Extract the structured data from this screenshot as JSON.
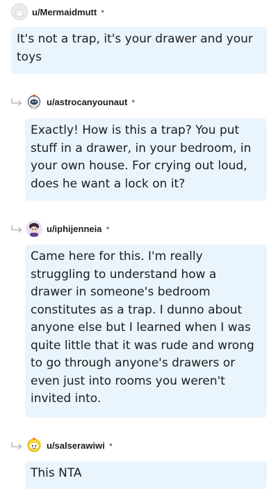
{
  "comments": [
    {
      "username": "u/Mermaidmutt",
      "separator": "•",
      "body": "It's not a trap, it's your drawer and your toys",
      "avatar": "default-grey-avatar-icon"
    },
    {
      "username": "u/astrocanyounaut",
      "separator": "•",
      "body": "Exactly! How is this a trap? You put stuff in a drawer, in your bedroom, in your own house. For crying out loud, does he want a lock on it?",
      "avatar": "astronaut-snoo-avatar-icon"
    },
    {
      "username": "u/iphijenneia",
      "separator": "•",
      "body": "Came here for this. I'm really struggling to understand how a drawer in someone's bedroom constitutes as a trap. I dunno about anyone else but I learned when I was quite little that it was rude and wrong to go through anyone's drawers or even just into rooms you weren't invited into.",
      "avatar": "purple-snoo-avatar-icon"
    },
    {
      "username": "u/salserawiwi",
      "separator": "•",
      "body": "This NTA",
      "avatar": "yellow-snoo-avatar-icon"
    }
  ],
  "colors": {
    "bubble": "#eaf4fd",
    "text": "#1c1c1c",
    "meta": "#7c7c7c"
  },
  "icons": {
    "reply": "reply-arrow-icon"
  }
}
